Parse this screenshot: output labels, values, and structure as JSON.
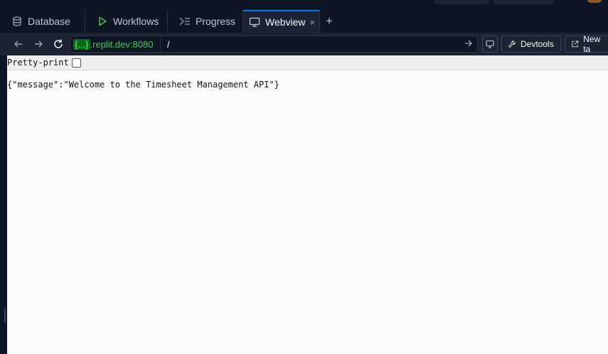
{
  "tabs": [
    {
      "label": "Database",
      "icon": "database-icon",
      "active": false
    },
    {
      "label": "Workflows",
      "icon": "play-icon",
      "active": false
    },
    {
      "label": "Progress",
      "icon": "progress-icon",
      "active": false
    },
    {
      "label": "Webview",
      "icon": "monitor-icon",
      "active": true
    }
  ],
  "tab_close_glyph": "×",
  "new_tab_glyph": "+",
  "address": {
    "host_highlight": "{...}",
    "host_domain": ".replit.dev:8080",
    "path": "/"
  },
  "toolbar": {
    "devtools_label": "Devtools",
    "newtab_label": "New ta"
  },
  "page": {
    "pretty_print_label": "Pretty-print",
    "pretty_print_checked": false,
    "body_text": "{\"message\":\"Welcome to the Timesheet Management API\"}"
  },
  "colors": {
    "accent": "#0079f2",
    "host_highlight_bg": "#046c19",
    "host_text": "#4cc859"
  }
}
